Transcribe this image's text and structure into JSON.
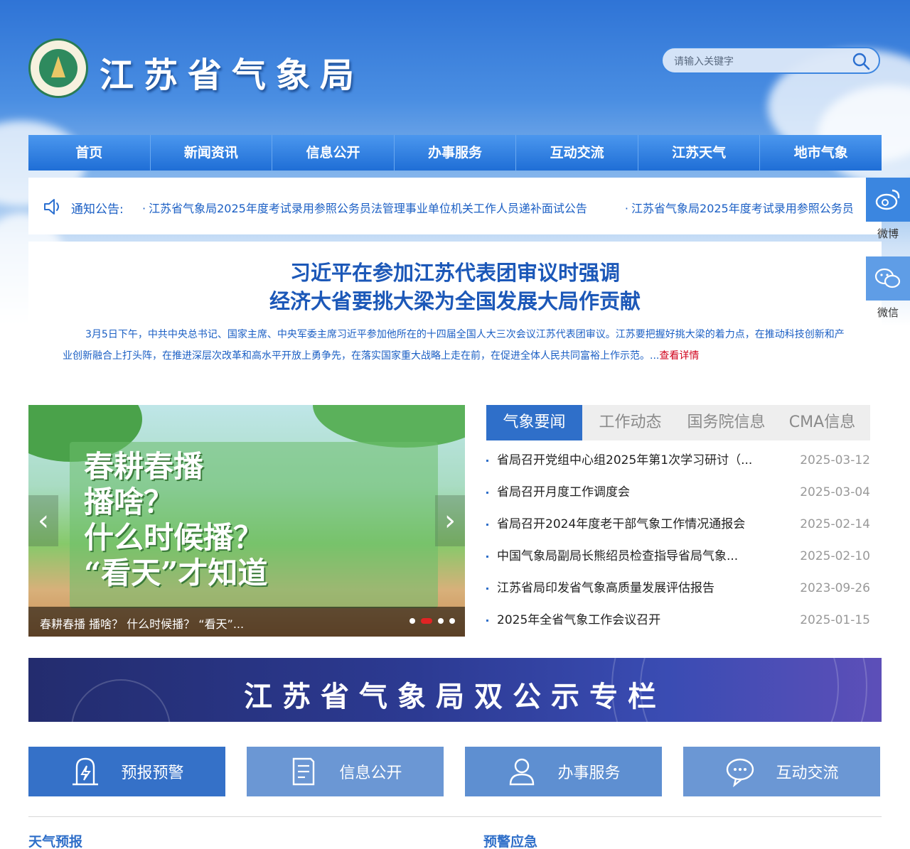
{
  "header": {
    "site_title": "江苏省气象局",
    "search_placeholder": "请输入关键字"
  },
  "nav": {
    "items": [
      "首页",
      "新闻资讯",
      "信息公开",
      "办事服务",
      "互动交流",
      "江苏天气",
      "地市气象"
    ]
  },
  "notice": {
    "label": "通知公告:",
    "items": [
      "江苏省气象局2025年度考试录用参照公务员法管理事业单位机关工作人员递补面试公告",
      "江苏省气象局2025年度考试录用参照公务员"
    ]
  },
  "headline": {
    "line1": "习近平在参加江苏代表团审议时强调",
    "line2": "经济大省要挑大梁为全国发展大局作贡献",
    "body": "3月5日下午，中共中央总书记、国家主席、中央军委主席习近平参加他所在的十四届全国人大三次会议江苏代表团审议。江苏要把握好挑大梁的着力点，在推动科技创新和产业创新融合上打头阵，在推进深层次改革和高水平开放上勇争先，在落实国家重大战略上走在前，在促进全体人民共同富裕上作示范。...",
    "more": "查看详情"
  },
  "side": {
    "weibo": "微博",
    "wechat": "微信"
  },
  "slider": {
    "slide_text": "春耕春播\n播啥？\n什么时候播？\n“看天”才知道",
    "caption": "春耕春播 播啥？ 什么时候播？ “看天”...",
    "prev": "‹",
    "next": "›"
  },
  "news": {
    "tabs": [
      "气象要闻",
      "工作动态",
      "国务院信息",
      "CMA信息"
    ],
    "items": [
      {
        "title": "省局召开党组中心组2025年第1次学习研讨（...",
        "date": "2025-03-12"
      },
      {
        "title": "省局召开月度工作调度会",
        "date": "2025-03-04"
      },
      {
        "title": "省局召开2024年度老干部气象工作情况通报会",
        "date": "2025-02-14"
      },
      {
        "title": "中国气象局副局长熊绍员检查指导省局气象...",
        "date": "2025-02-10"
      },
      {
        "title": "江苏省局印发省气象高质量发展评估报告",
        "date": "2023-09-26"
      },
      {
        "title": "2025年全省气象工作会议召开",
        "date": "2025-01-15"
      }
    ]
  },
  "banner": {
    "text": "江苏省气象局双公示专栏"
  },
  "quick": {
    "items": [
      {
        "label": "预报预警",
        "icon": "lightning-icon",
        "color": "#3571c8"
      },
      {
        "label": "信息公开",
        "icon": "document-icon",
        "color": "#6b97d4"
      },
      {
        "label": "办事服务",
        "icon": "user-icon",
        "color": "#5e8fd1"
      },
      {
        "label": "互动交流",
        "icon": "chat-icon",
        "color": "#6b97d4"
      }
    ]
  },
  "sections": {
    "left": "天气预报",
    "right": "预警应急"
  }
}
